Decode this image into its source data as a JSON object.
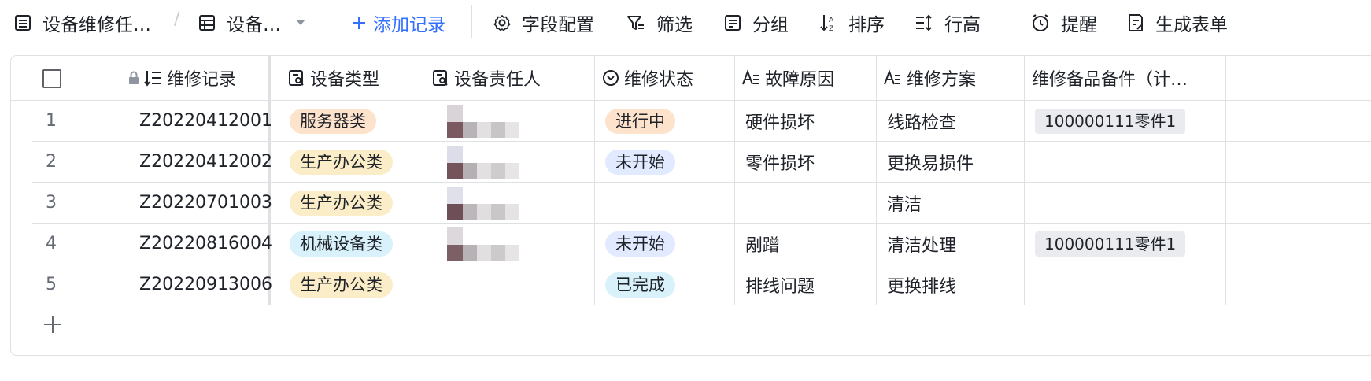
{
  "toolbar": {
    "table_name": "设备维修任…",
    "view_name": "设备…",
    "add_record": "添加记录",
    "field_config": "字段配置",
    "filter": "筛选",
    "group": "分组",
    "sort": "排序",
    "row_height": "行高",
    "reminder": "提醒",
    "generate_form": "生成表单"
  },
  "columns": {
    "record": "维修记录",
    "device_type": "设备类型",
    "owner": "设备责任人",
    "status": "维修状态",
    "fault": "故障原因",
    "plan": "维修方案",
    "parts": "维修备品备件（计…"
  },
  "rows": [
    {
      "num": "1",
      "record": "Z20220412001",
      "device_type": "服务器类",
      "status": "进行中",
      "fault": "硬件损坏",
      "plan": "线路检查",
      "parts": "100000111零件1"
    },
    {
      "num": "2",
      "record": "Z20220412002",
      "device_type": "生产办公类",
      "status": "未开始",
      "fault": "零件损坏",
      "plan": "更换易损件",
      "parts": ""
    },
    {
      "num": "3",
      "record": "Z20220701003",
      "device_type": "生产办公类",
      "status": "",
      "fault": "",
      "plan": "清洁",
      "parts": ""
    },
    {
      "num": "4",
      "record": "Z20220816004",
      "device_type": "机械设备类",
      "status": "未开始",
      "fault": "剐蹭",
      "plan": "清洁处理",
      "parts": "100000111零件1"
    },
    {
      "num": "5",
      "record": "Z20220913006",
      "device_type": "生产办公类",
      "status": "已完成",
      "fault": "排线问题",
      "plan": "更换排线",
      "parts": ""
    }
  ],
  "colors": {
    "accent": "#3370ff",
    "tag_server": "#fde2cc",
    "tag_office": "#fbedc7",
    "tag_machine": "#d9f1fb",
    "status_in_progress": "#fde2cc",
    "status_not_started": "#e1eaff",
    "status_done": "#d9f1fb",
    "chip": "#e9ebee"
  }
}
